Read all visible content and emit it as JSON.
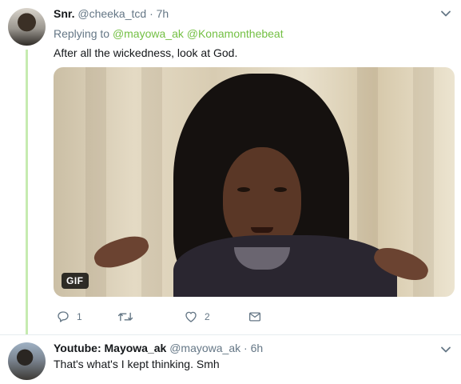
{
  "tweets": [
    {
      "name": "Snr.",
      "handle": "@cheeka_tcd",
      "dot": "·",
      "time": "7h",
      "replying_prefix": "Replying to",
      "replying_to": [
        "@mayowa_ak",
        "@Konamonthebeat"
      ],
      "text": "After all the wickedness, look at God.",
      "media": {
        "badge": "GIF"
      },
      "actions": {
        "reply": {
          "icon": "reply-icon",
          "count": "1"
        },
        "retweet": {
          "icon": "retweet-icon",
          "count": ""
        },
        "like": {
          "icon": "heart-icon",
          "count": "2"
        },
        "dm": {
          "icon": "envelope-icon"
        }
      }
    },
    {
      "name": "Youtube: Mayowa_ak",
      "handle": "@mayowa_ak",
      "dot": "·",
      "time": "6h",
      "text": "That's what's I kept thinking. Smh"
    }
  ],
  "colors": {
    "thread_line": "#c6ebb0",
    "link": "#74c044",
    "secondary_text": "#657786",
    "primary_text": "#14171a"
  }
}
